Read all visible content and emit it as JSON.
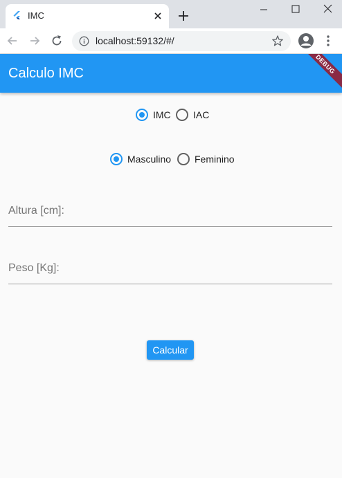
{
  "browser": {
    "tab_title": "IMC",
    "url": "localhost:59132/#/"
  },
  "app": {
    "title": "Calculo IMC",
    "debug_banner": "DEBUG",
    "accent_color": "#2196f3"
  },
  "calc_type": {
    "options": [
      "IMC",
      "IAC"
    ],
    "selected": "IMC"
  },
  "sex": {
    "options": [
      "Masculino",
      "Feminino"
    ],
    "selected": "Masculino"
  },
  "fields": {
    "height_label": "Altura [cm]:",
    "weight_label": "Peso [Kg]:"
  },
  "button": {
    "label": "Calcular"
  }
}
